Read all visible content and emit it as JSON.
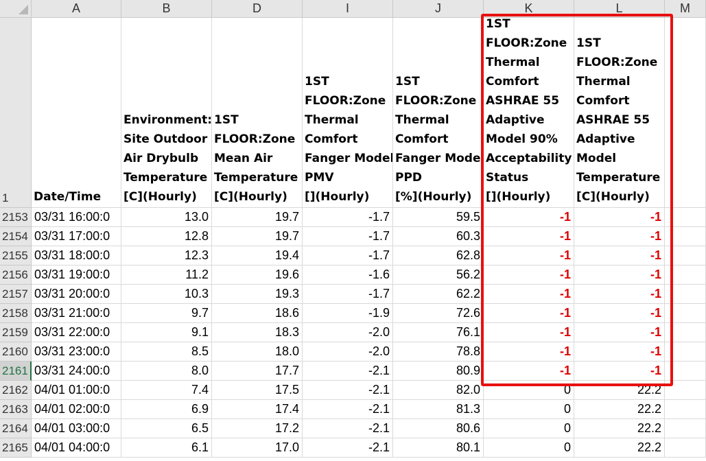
{
  "columns": [
    {
      "letter": "A",
      "header": [
        "Date/Time"
      ]
    },
    {
      "letter": "B",
      "header": [
        "Environment:",
        "Site Outdoor",
        "Air Drybulb",
        "Temperature",
        "[C](Hourly)"
      ]
    },
    {
      "letter": "D",
      "header": [
        "1ST",
        "FLOOR:Zone",
        "Mean Air",
        "Temperature",
        "[C](Hourly)"
      ]
    },
    {
      "letter": "I",
      "header": [
        "1ST",
        "FLOOR:Zone",
        "Thermal",
        "Comfort",
        "Fanger Model",
        "PMV",
        "[](Hourly)"
      ]
    },
    {
      "letter": "J",
      "header": [
        "1ST",
        "FLOOR:Zone",
        "Thermal",
        "Comfort",
        "Fanger Model",
        "PPD",
        "[%](Hourly)"
      ]
    },
    {
      "letter": "K",
      "header": [
        "1ST",
        "FLOOR:Zone",
        "Thermal",
        "Comfort",
        "ASHRAE 55",
        "Adaptive",
        "Model 90%",
        "Acceptability",
        "Status",
        "[](Hourly)"
      ]
    },
    {
      "letter": "L",
      "header": [
        "1ST",
        "FLOOR:Zone",
        "Thermal",
        "Comfort",
        "ASHRAE 55",
        "Adaptive",
        "Model",
        "Temperature",
        "[C](Hourly)"
      ]
    },
    {
      "letter": "M",
      "header": []
    }
  ],
  "header_row_number": "1",
  "selected_row": "2161",
  "rows": [
    {
      "num": "2153",
      "cells": [
        "03/31  16:00:0",
        "13.0",
        "19.7",
        "-1.7",
        "59.5",
        "-1",
        "-1"
      ],
      "highlight": true
    },
    {
      "num": "2154",
      "cells": [
        "03/31  17:00:0",
        "12.8",
        "19.7",
        "-1.7",
        "60.3",
        "-1",
        "-1"
      ],
      "highlight": true
    },
    {
      "num": "2155",
      "cells": [
        "03/31  18:00:0",
        "12.3",
        "19.4",
        "-1.7",
        "62.8",
        "-1",
        "-1"
      ],
      "highlight": true
    },
    {
      "num": "2156",
      "cells": [
        "03/31  19:00:0",
        "11.2",
        "19.6",
        "-1.6",
        "56.2",
        "-1",
        "-1"
      ],
      "highlight": true
    },
    {
      "num": "2157",
      "cells": [
        "03/31  20:00:0",
        "10.3",
        "19.3",
        "-1.7",
        "62.2",
        "-1",
        "-1"
      ],
      "highlight": true
    },
    {
      "num": "2158",
      "cells": [
        "03/31  21:00:0",
        "9.7",
        "18.6",
        "-1.9",
        "72.6",
        "-1",
        "-1"
      ],
      "highlight": true
    },
    {
      "num": "2159",
      "cells": [
        "03/31  22:00:0",
        "9.1",
        "18.3",
        "-2.0",
        "76.1",
        "-1",
        "-1"
      ],
      "highlight": true
    },
    {
      "num": "2160",
      "cells": [
        "03/31  23:00:0",
        "8.5",
        "18.0",
        "-2.0",
        "78.8",
        "-1",
        "-1"
      ],
      "highlight": true
    },
    {
      "num": "2161",
      "cells": [
        "03/31  24:00:0",
        "8.0",
        "17.7",
        "-2.1",
        "80.9",
        "-1",
        "-1"
      ],
      "highlight": true
    },
    {
      "num": "2162",
      "cells": [
        "04/01  01:00:0",
        "7.4",
        "17.5",
        "-2.1",
        "82.0",
        "0",
        "22.2"
      ],
      "highlight": false
    },
    {
      "num": "2163",
      "cells": [
        "04/01  02:00:0",
        "6.9",
        "17.4",
        "-2.1",
        "81.3",
        "0",
        "22.2"
      ],
      "highlight": false
    },
    {
      "num": "2164",
      "cells": [
        "04/01  03:00:0",
        "6.5",
        "17.2",
        "-2.1",
        "80.6",
        "0",
        "22.2"
      ],
      "highlight": false
    },
    {
      "num": "2165",
      "cells": [
        "04/01  04:00:0",
        "6.1",
        "17.0",
        "-2.1",
        "80.1",
        "0",
        "22.2"
      ],
      "highlight": false
    }
  ],
  "colors": {
    "highlight_border": "#e81010",
    "negative_text": "#e00000",
    "selected_row_text": "#217346"
  }
}
